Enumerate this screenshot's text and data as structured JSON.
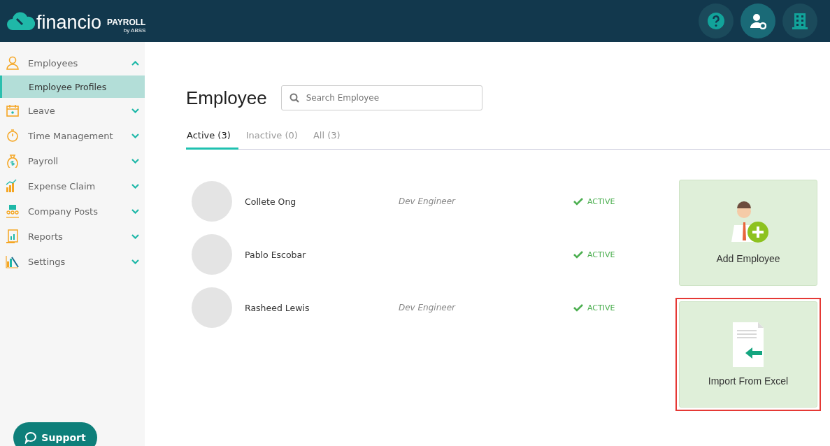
{
  "header": {
    "logo_text": "financio",
    "product": "PAYROLL",
    "vendor": "by ABSS",
    "buttons": [
      {
        "kind": "help",
        "selected": false
      },
      {
        "kind": "user-settings",
        "selected": true
      },
      {
        "kind": "building",
        "selected": false
      }
    ]
  },
  "sidebar": {
    "items": [
      {
        "label": "Employees",
        "kind": "person",
        "expanded": true,
        "children": [
          {
            "label": "Employee Profiles",
            "selected": true
          }
        ]
      },
      {
        "label": "Leave",
        "kind": "calendar",
        "expanded": false
      },
      {
        "label": "Time Management",
        "kind": "stopwatch",
        "expanded": false
      },
      {
        "label": "Payroll",
        "kind": "money-bag",
        "expanded": false
      },
      {
        "label": "Expense Claim",
        "kind": "chart",
        "expanded": false
      },
      {
        "label": "Company Posts",
        "kind": "people",
        "expanded": false
      },
      {
        "label": "Reports",
        "kind": "report",
        "expanded": false
      },
      {
        "label": "Settings",
        "kind": "tools",
        "expanded": false
      }
    ],
    "support": "Support"
  },
  "page": {
    "title": "Employee",
    "search": {
      "placeholder": "Search Employee"
    },
    "tabs": [
      {
        "label": "Active (3)",
        "selected": true
      },
      {
        "label": "Inactive (0)",
        "selected": false
      },
      {
        "label": "All (3)",
        "selected": false
      }
    ],
    "employees": [
      {
        "name": "Collete Ong",
        "role": "Dev Engineer",
        "status": "ACTIVE"
      },
      {
        "name": "Pablo Escobar",
        "status": "ACTIVE"
      },
      {
        "name": "Rasheed Lewis",
        "role": "Dev Engineer",
        "status": "ACTIVE"
      }
    ],
    "actions": [
      {
        "label": "Add Employee",
        "kind": "add",
        "highlighted": false
      },
      {
        "label": "Import From Excel",
        "kind": "import",
        "highlighted": true
      }
    ]
  }
}
